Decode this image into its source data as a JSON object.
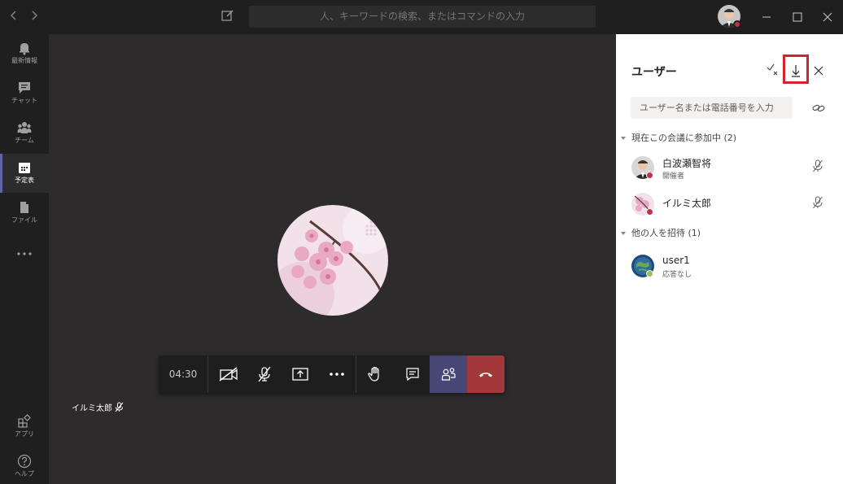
{
  "search": {
    "placeholder": "人、キーワードの検索、またはコマンドの入力"
  },
  "rail": [
    {
      "label": "最新情報",
      "icon": "bell-icon"
    },
    {
      "label": "チャット",
      "icon": "chat-icon"
    },
    {
      "label": "チーム",
      "icon": "teams-icon"
    },
    {
      "label": "予定表",
      "icon": "calendar-icon"
    },
    {
      "label": "ファイル",
      "icon": "file-icon"
    },
    {
      "label": "アプリ",
      "icon": "apps-icon"
    },
    {
      "label": "ヘルプ",
      "icon": "help-icon"
    }
  ],
  "stage": {
    "name": "イルミ太郎",
    "timer": "04:30"
  },
  "panel": {
    "title": "ユーザー",
    "search_placeholder": "ユーザー名または電話番号を入力",
    "in_meeting_header": "現在この会議に参加中 (2)",
    "invite_header": "他の人を招待 (1)",
    "participants": [
      {
        "name": "白波瀬智将",
        "role": "開催者",
        "status_color": "#c4314b"
      },
      {
        "name": "イルミ太郎",
        "role": "",
        "status_color": "#c4314b"
      }
    ],
    "invited": [
      {
        "name": "user1",
        "status": "応答なし",
        "status_color": "#92c353"
      }
    ]
  },
  "colors": {
    "accent": "#6264a7",
    "hangup": "#a4373a",
    "highlight": "#d1252e"
  }
}
